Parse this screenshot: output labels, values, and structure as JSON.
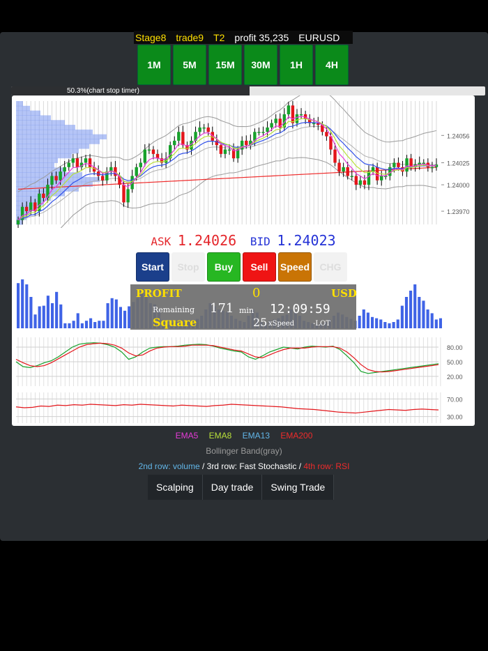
{
  "status": {
    "stage": "Stage8",
    "trade": "trade9",
    "tier": "T2",
    "profit": "profit 35,235",
    "symbol": "EURUSD"
  },
  "timeframes": [
    "1M",
    "5M",
    "15M",
    "30M",
    "1H",
    "4H"
  ],
  "timer": {
    "label": "50.3%(chart stop timer)",
    "progress": 0.503
  },
  "quote": {
    "ask_label": "ASK",
    "ask_value": "1.24026",
    "bid_label": "BID",
    "bid_value": "1.24023"
  },
  "actions": [
    {
      "label": "Start",
      "bg": "#1b3f8b",
      "fg": "#ffffff",
      "disabled": false
    },
    {
      "label": "Stop",
      "bg": "#f2f2f2",
      "fg": "#dddddd",
      "disabled": true
    },
    {
      "label": "Buy",
      "bg": "#27b722",
      "fg": "#ffffff",
      "disabled": false
    },
    {
      "label": "Sell",
      "bg": "#ef1414",
      "fg": "#ffffff",
      "disabled": false
    },
    {
      "label": "Speed",
      "bg": "#c97405",
      "fg": "#ffffff",
      "disabled": false
    },
    {
      "label": "CHG",
      "bg": "#f2f2f2",
      "fg": "#dddddd",
      "disabled": true
    }
  ],
  "profit_panel": {
    "profit_label": "PROFIT",
    "profit_value": "0",
    "currency": "USD",
    "remaining_label": "Remaining",
    "remaining_value": "171",
    "remaining_unit": "min",
    "clock": "12:09:59",
    "mode": "Square",
    "speed_value": "25",
    "speed_label": "xSpeed",
    "lot_label": "-LOT"
  },
  "chart_data": {
    "type": "candlestick",
    "y_ticks": [
      "1.24056",
      "1.24025",
      "1.24000",
      "1.23970"
    ],
    "stoch_ticks": [
      "80.00",
      "50.00",
      "20.00"
    ],
    "rsi_ticks": [
      "70.00",
      "30.00"
    ],
    "closes": [
      1.2396,
      1.23975,
      1.2397,
      1.2398,
      1.2397,
      1.2399,
      1.23985,
      1.24,
      1.2401,
      1.24005,
      1.24015,
      1.2402,
      1.24025,
      1.2403,
      1.2402,
      1.24025,
      1.2403,
      1.2402,
      1.24015,
      1.2401,
      1.24005,
      1.24015,
      1.2402,
      1.2401,
      1.24,
      1.2398,
      1.23995,
      1.2401,
      1.2402,
      1.24025,
      1.2404,
      1.2404,
      1.24035,
      1.2403,
      1.24025,
      1.2403,
      1.24045,
      1.2405,
      1.2406,
      1.24045,
      1.2404,
      1.2405,
      1.2406,
      1.24065,
      1.24065,
      1.2406,
      1.2405,
      1.24045,
      1.24035,
      1.2404,
      1.2404,
      1.2403,
      1.2404,
      1.2405,
      1.24045,
      1.2405,
      1.2406,
      1.2406,
      1.2406,
      1.24065,
      1.2407,
      1.24075,
      1.24065,
      1.2408,
      1.2409,
      1.2407,
      1.2408,
      1.2408,
      1.24075,
      1.2407,
      1.2407,
      1.24068,
      1.2406,
      1.24055,
      1.2404,
      1.24025,
      1.24015,
      1.2402,
      1.2401,
      1.2401,
      1.24,
      1.24005,
      1.24,
      1.24015,
      1.2402,
      1.24005,
      1.2401,
      1.2401,
      1.2402,
      1.24025,
      1.2402,
      1.24015,
      1.2403,
      1.2402,
      1.24023,
      1.24025,
      1.24025,
      1.2402,
      1.2402,
      1.24023
    ],
    "volume": [
      72,
      78,
      70,
      50,
      22,
      35,
      36,
      52,
      40,
      58,
      38,
      8,
      8,
      12,
      24,
      8,
      12,
      16,
      10,
      12,
      12,
      40,
      48,
      46,
      34,
      28,
      35,
      42,
      48,
      60,
      55,
      40,
      38,
      30,
      12,
      6,
      8,
      10,
      8,
      10,
      12,
      12,
      15,
      20,
      30,
      40,
      35,
      30,
      28,
      26,
      20,
      15,
      12,
      10,
      20,
      30,
      25,
      10,
      8,
      12,
      14,
      16,
      20,
      22,
      30,
      26,
      20,
      12,
      10,
      8,
      6,
      8,
      10,
      14,
      20,
      25,
      22,
      18,
      15,
      12,
      20,
      30,
      25,
      18,
      16,
      14,
      10,
      8,
      10,
      14,
      36,
      50,
      60,
      70,
      50,
      44,
      30,
      24,
      14,
      16
    ],
    "stoch_green": [
      50,
      40,
      38,
      42,
      48,
      52,
      60,
      70,
      80,
      86,
      88,
      89,
      88,
      85,
      80,
      70,
      55,
      60,
      70,
      78,
      80,
      81,
      81,
      82,
      84,
      85,
      86,
      85,
      82,
      78,
      75,
      72,
      70,
      60,
      55,
      62,
      70,
      75,
      80,
      78,
      76,
      80,
      82,
      81,
      80,
      82,
      75,
      62,
      48,
      30,
      26,
      28,
      30,
      32,
      34,
      36,
      38,
      40,
      42,
      44,
      46
    ],
    "stoch_red": [
      55,
      48,
      42,
      40,
      42,
      48,
      56,
      64,
      72,
      80,
      85,
      87,
      88,
      87,
      84,
      78,
      68,
      62,
      64,
      72,
      78,
      80,
      81,
      81,
      82,
      84,
      84,
      84,
      83,
      80,
      77,
      74,
      72,
      66,
      60,
      58,
      64,
      70,
      75,
      78,
      78,
      78,
      80,
      81,
      81,
      81,
      78,
      70,
      58,
      44,
      34,
      30,
      29,
      30,
      32,
      34,
      36,
      38,
      40,
      42,
      44
    ],
    "rsi_red": [
      52,
      50,
      51,
      54,
      53,
      56,
      55,
      57,
      56,
      58,
      57,
      56,
      55,
      57,
      56,
      58,
      57,
      56,
      55,
      54,
      56,
      55,
      54,
      53,
      55,
      56,
      58,
      57,
      56,
      55,
      54,
      53,
      52,
      50,
      48,
      47,
      46,
      44,
      42,
      40,
      39,
      38,
      40,
      42,
      44,
      46,
      45,
      44,
      46,
      47,
      46,
      45
    ]
  },
  "legend": [
    {
      "label": "EMA5",
      "color": "#e63bd8"
    },
    {
      "label": "EMA8",
      "color": "#b9e03a"
    },
    {
      "label": "EMA13",
      "color": "#62b6e8"
    },
    {
      "label": "EMA200",
      "color": "#ef2b2b"
    }
  ],
  "bollinger_label": "Bollinger Band(gray)",
  "rows_label": {
    "part1": "2nd row: volume",
    "sep1": " / ",
    "part2": "3rd row: Fast Stochastic",
    "sep2": " / ",
    "part3": "4th row: RSI",
    "color1": "#62b6e8",
    "color3": "#ef2b2b"
  },
  "modes": [
    "Scalping",
    "Day trade",
    "Swing Trade"
  ]
}
